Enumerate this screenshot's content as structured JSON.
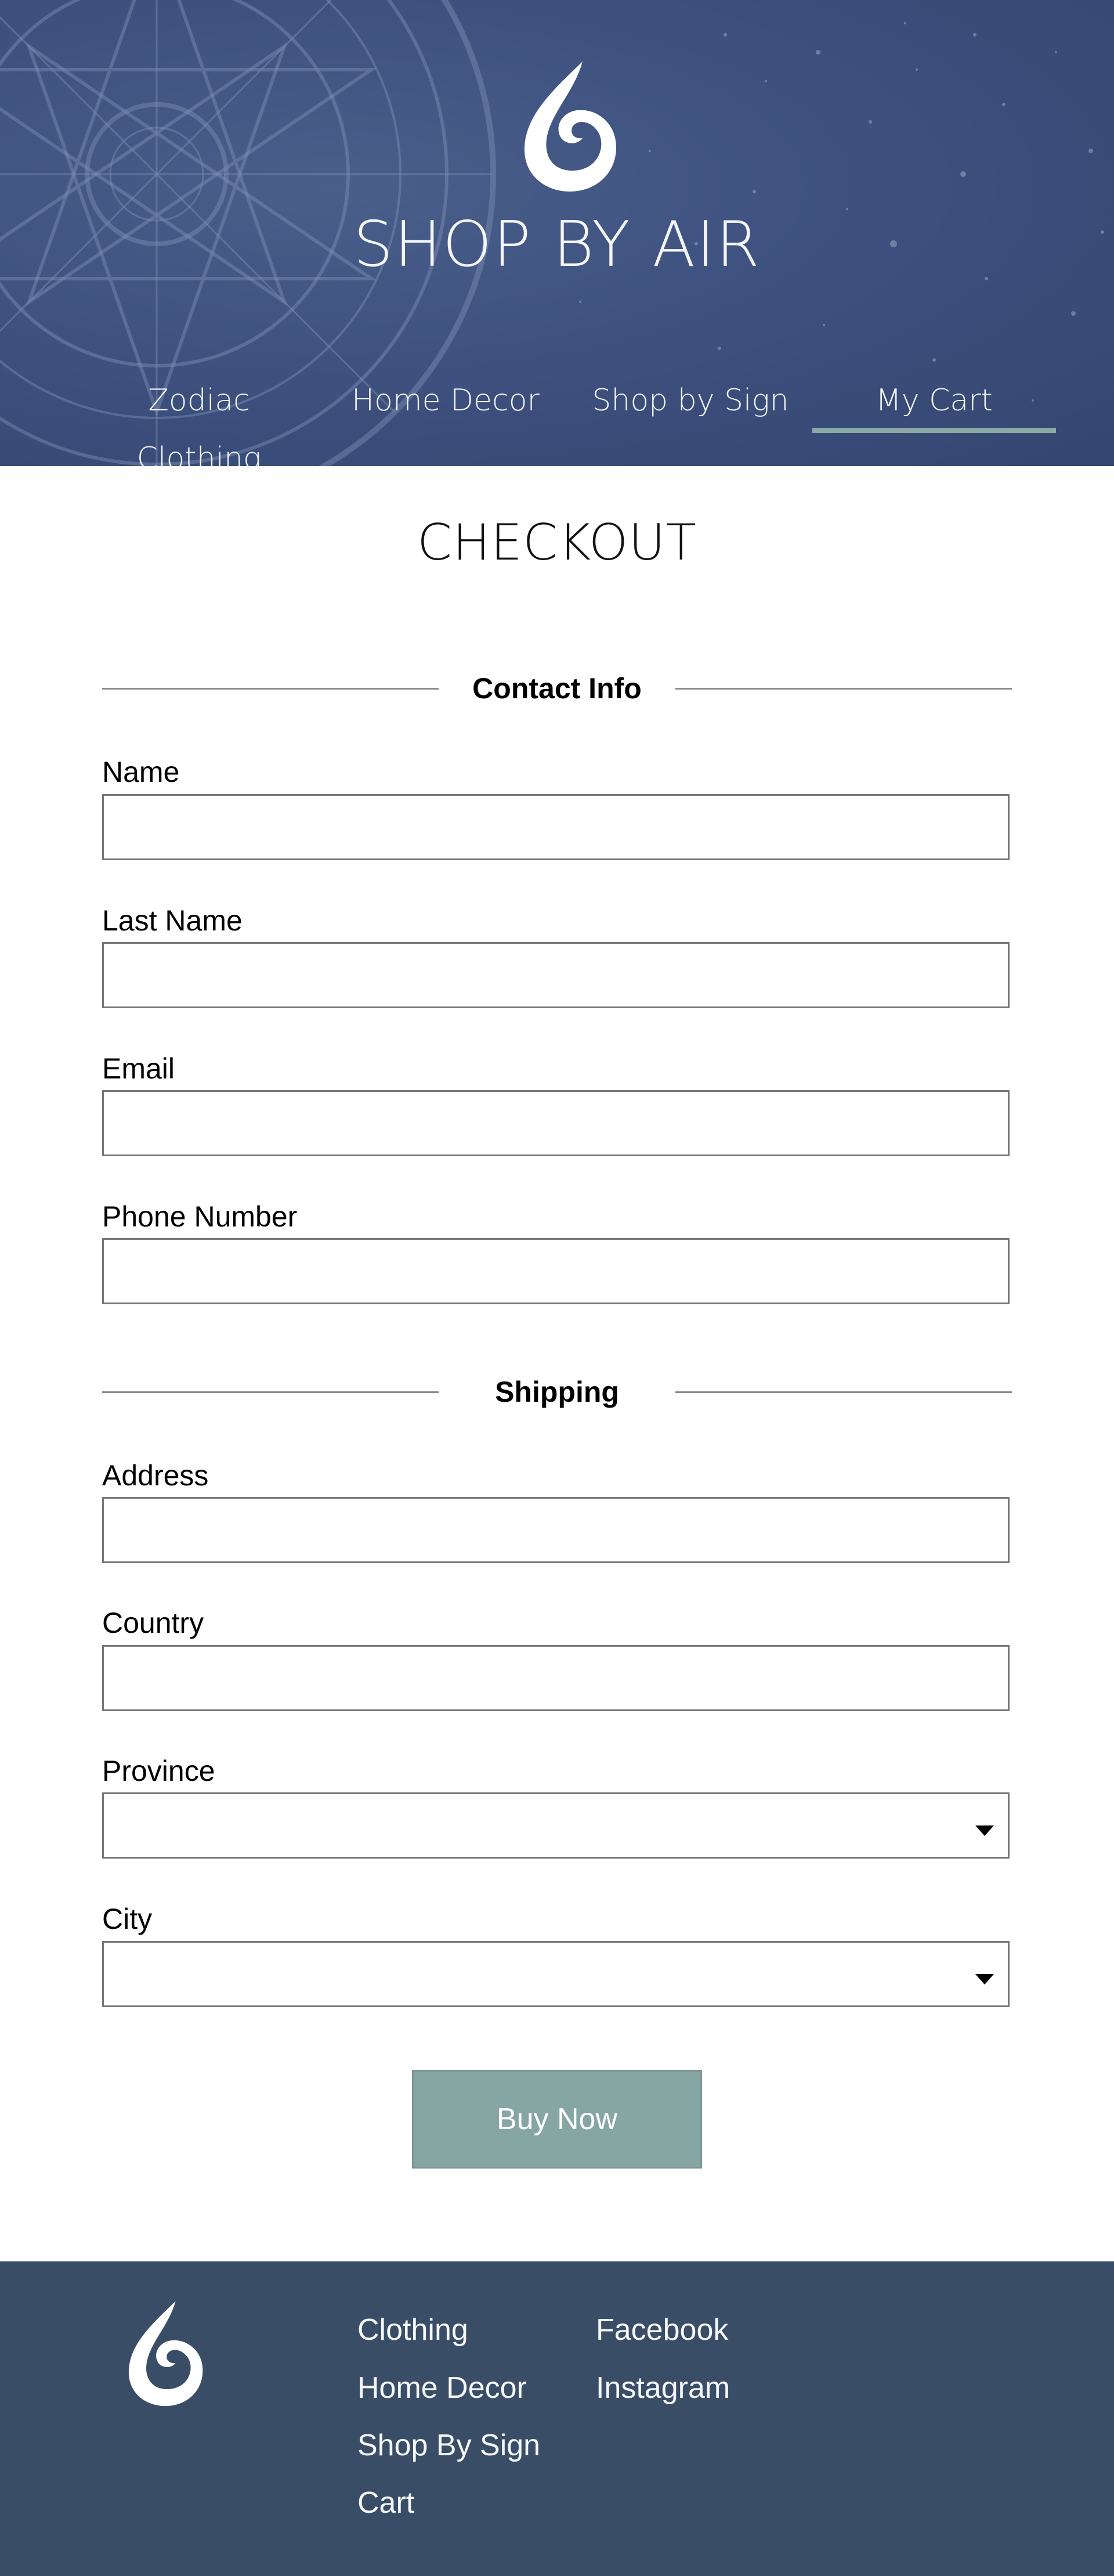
{
  "brand": {
    "name": "SHOP BY AIR",
    "logo_icon": "air-swirl-logo-icon",
    "background": "zodiac-wheel-starfield"
  },
  "nav": {
    "items": [
      {
        "label": "Zodiac Clothing"
      },
      {
        "label": "Home Decor"
      },
      {
        "label": "Shop by Sign"
      },
      {
        "label": "My Cart",
        "active": true
      }
    ]
  },
  "page": {
    "title": "CHECKOUT"
  },
  "contact": {
    "heading": "Contact Info",
    "fields": [
      {
        "label": "Name",
        "value": "",
        "placeholder": ""
      },
      {
        "label": "Last Name",
        "value": "",
        "placeholder": ""
      },
      {
        "label": "Email",
        "value": "",
        "placeholder": ""
      },
      {
        "label": "Phone Number",
        "value": "",
        "placeholder": ""
      }
    ]
  },
  "shipping": {
    "heading": "Shipping",
    "fields": [
      {
        "label": "Address",
        "value": "",
        "placeholder": ""
      },
      {
        "label": "Country",
        "value": "",
        "placeholder": ""
      },
      {
        "label": "Province",
        "value": "",
        "type": "select"
      },
      {
        "label": "City",
        "value": "",
        "type": "select"
      }
    ]
  },
  "actions": {
    "buy_label": "Buy Now"
  },
  "footer": {
    "col1": [
      "Clothing",
      "Home Decor",
      "Shop By Sign",
      "Cart"
    ],
    "col2": [
      "Facebook",
      "Instagram"
    ]
  },
  "colors": {
    "header_bg": "#3e5180",
    "nav_active_underline": "#8aa8a5",
    "button_bg": "#86a6a4",
    "footer_bg": "#394e66"
  }
}
